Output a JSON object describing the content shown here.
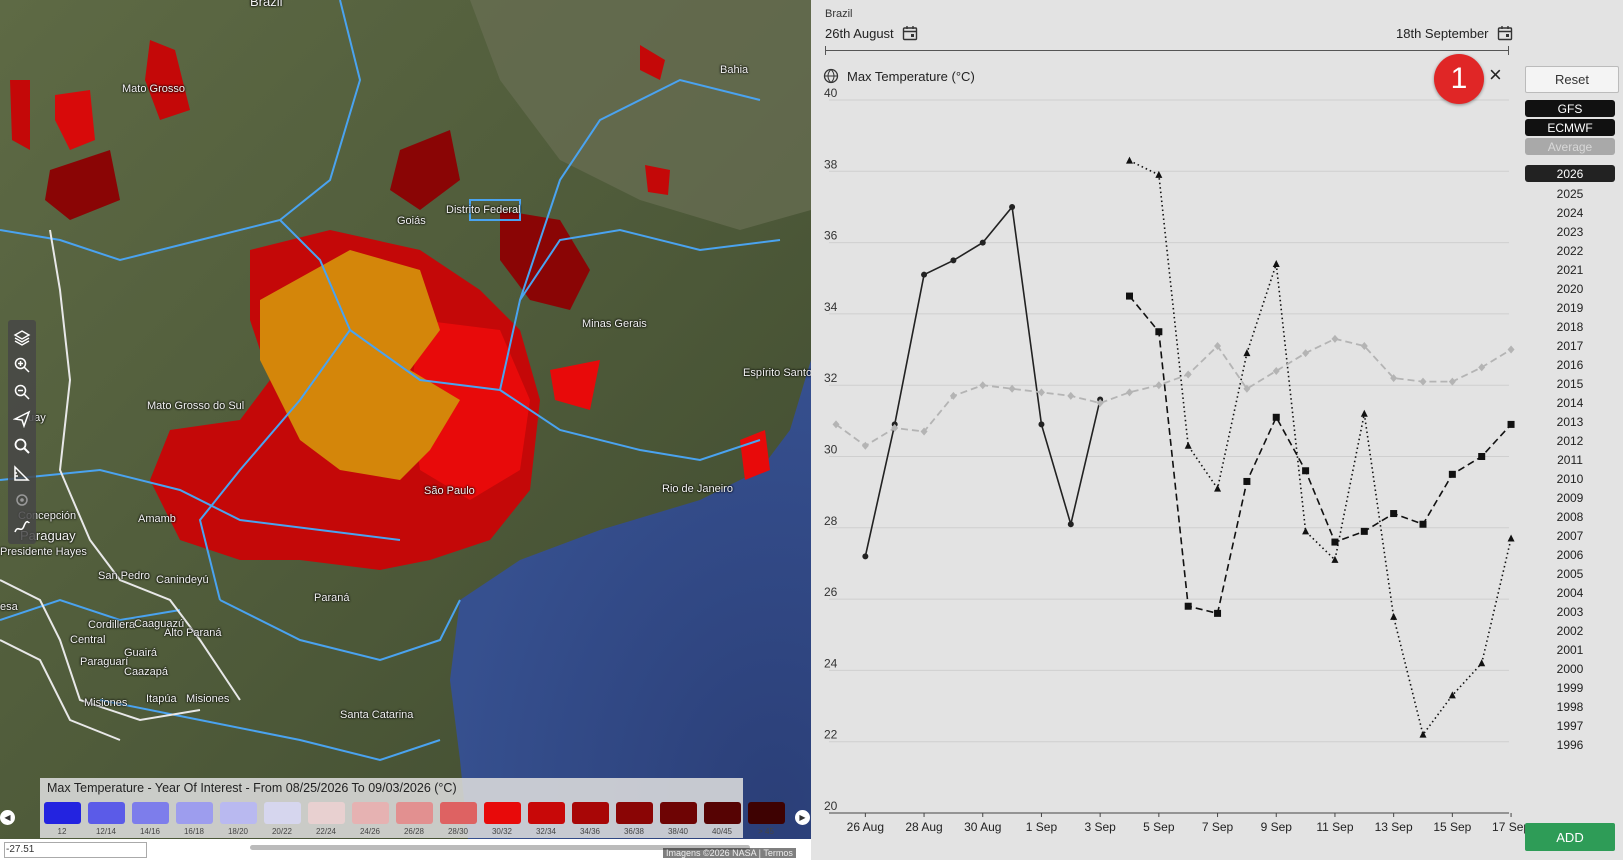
{
  "map": {
    "places": [
      "Brazil",
      "Mato Grosso",
      "Bahia",
      "Goiás",
      "Distrito Federal",
      "Minas Gerais",
      "Espírito Santo",
      "Mato Grosso do Sul",
      "São Paulo",
      "Rio de Janeiro",
      "Paraguay",
      "Concepción",
      "Amamb",
      "Presidente Hayes",
      "San Pedro",
      "Canindeyú",
      "Paraná",
      "Cordillera",
      "Caaguazú",
      "Central",
      "Alto Paraná",
      "Guairá",
      "Paraguarí",
      "Caazapá",
      "Itapúa",
      "Misiones",
      "Misiones",
      "Santa Catarina",
      "uay",
      "esa"
    ],
    "tools": [
      "layers-icon",
      "zoom-in-icon",
      "zoom-out-icon",
      "navigate-icon",
      "search-icon",
      "measure-icon",
      "location-icon",
      "draw-icon"
    ],
    "legend": {
      "title": "Max Temperature - Year Of Interest - From 08/25/2026 To 09/03/2026 (°C)",
      "bins": [
        {
          "label": "12",
          "color": "#2323e0"
        },
        {
          "label": "12/14",
          "color": "#5b5be8"
        },
        {
          "label": "14/16",
          "color": "#7d7deb"
        },
        {
          "label": "16/18",
          "color": "#9d9dee"
        },
        {
          "label": "18/20",
          "color": "#b9b9f0"
        },
        {
          "label": "20/22",
          "color": "#d6d6ee"
        },
        {
          "label": "22/24",
          "color": "#e8d0d0"
        },
        {
          "label": "24/26",
          "color": "#e6b2b2"
        },
        {
          "label": "26/28",
          "color": "#e29090"
        },
        {
          "label": "28/30",
          "color": "#de6262"
        },
        {
          "label": "30/32",
          "color": "#e80a0a"
        },
        {
          "label": "32/34",
          "color": "#c80808"
        },
        {
          "label": "34/36",
          "color": "#a80606"
        },
        {
          "label": "36/38",
          "color": "#8a0505"
        },
        {
          "label": "38/40",
          "color": "#6e0404"
        },
        {
          "label": "40/45",
          "color": "#560303"
        },
        {
          "label": "> 45",
          "color": "#3e0202"
        }
      ]
    },
    "coordinate": "-27.51",
    "attribution": "Imagens ©2026 NASA | Termos"
  },
  "panel": {
    "region": "Brazil",
    "date_start": "26th August",
    "date_end": "18th September",
    "chart_title": "Max Temperature (°C)",
    "badge": "1",
    "close_glyph": "×",
    "reset_label": "Reset",
    "series_buttons": [
      {
        "label": "GFS",
        "bg": "#111111",
        "fg": "#ffffff"
      },
      {
        "label": "ECMWF",
        "bg": "#111111",
        "fg": "#ffffff"
      },
      {
        "label": "Average",
        "bg": "#a9a9a9",
        "fg": "#d8d8d8"
      }
    ],
    "years": [
      "2026",
      "2025",
      "2024",
      "2023",
      "2022",
      "2021",
      "2020",
      "2019",
      "2018",
      "2017",
      "2016",
      "2015",
      "2014",
      "2013",
      "2012",
      "2011",
      "2010",
      "2009",
      "2008",
      "2007",
      "2006",
      "2005",
      "2004",
      "2003",
      "2002",
      "2001",
      "2000",
      "1999",
      "1998",
      "1997",
      "1996"
    ],
    "active_year": "2026",
    "add_label": "ADD"
  },
  "chart_data": {
    "type": "line",
    "title": "Max Temperature (°C)",
    "ylim": [
      20,
      40
    ],
    "yticks": [
      20,
      22,
      24,
      26,
      28,
      30,
      32,
      34,
      36,
      38,
      40
    ],
    "xticks": [
      "26 Aug",
      "28 Aug",
      "30 Aug",
      "1 Sep",
      "3 Sep",
      "5 Sep",
      "7 Sep",
      "9 Sep",
      "11 Sep",
      "13 Sep",
      "15 Sep",
      "17 Sep"
    ],
    "x_dates": [
      "25 Aug",
      "26 Aug",
      "27 Aug",
      "28 Aug",
      "29 Aug",
      "30 Aug",
      "31 Aug",
      "1 Sep",
      "2 Sep",
      "3 Sep",
      "4 Sep",
      "5 Sep",
      "6 Sep",
      "7 Sep",
      "8 Sep",
      "9 Sep",
      "10 Sep",
      "11 Sep",
      "12 Sep",
      "13 Sep",
      "14 Sep",
      "15 Sep",
      "16 Sep",
      "17 Sep",
      "18 Sep"
    ],
    "series": [
      {
        "values": [
          null,
          27.2,
          30.9,
          35.1,
          35.5,
          36.0,
          37.0,
          30.9,
          28.1,
          31.6,
          null,
          null,
          null,
          null,
          null,
          null,
          null,
          null,
          null,
          null,
          null,
          null,
          null,
          null,
          null
        ],
        "style": "solid",
        "marker": "circle",
        "color": "#222222"
      },
      {
        "values": [
          null,
          null,
          null,
          null,
          null,
          null,
          null,
          null,
          null,
          null,
          34.5,
          33.5,
          25.8,
          25.6,
          29.3,
          31.1,
          29.6,
          27.6,
          27.9,
          28.4,
          28.1,
          29.5,
          30.0,
          30.9,
          null
        ],
        "style": "dashed",
        "marker": "square",
        "color": "#111111"
      },
      {
        "values": [
          null,
          null,
          null,
          null,
          null,
          null,
          null,
          null,
          null,
          null,
          38.3,
          37.9,
          30.3,
          29.1,
          32.9,
          35.4,
          27.9,
          27.1,
          31.2,
          25.5,
          22.2,
          23.3,
          24.2,
          27.7,
          null
        ],
        "style": "dotted",
        "marker": "triangle",
        "color": "#111111"
      },
      {
        "values": [
          30.9,
          30.3,
          30.8,
          30.7,
          31.7,
          32.0,
          31.9,
          31.8,
          31.7,
          31.5,
          31.8,
          32.0,
          32.3,
          33.1,
          31.9,
          32.4,
          32.9,
          33.3,
          33.1,
          32.2,
          32.1,
          32.1,
          32.5,
          33.0,
          null
        ],
        "style": "dashed",
        "marker": "diamond",
        "color": "#b4b4b4"
      }
    ]
  }
}
